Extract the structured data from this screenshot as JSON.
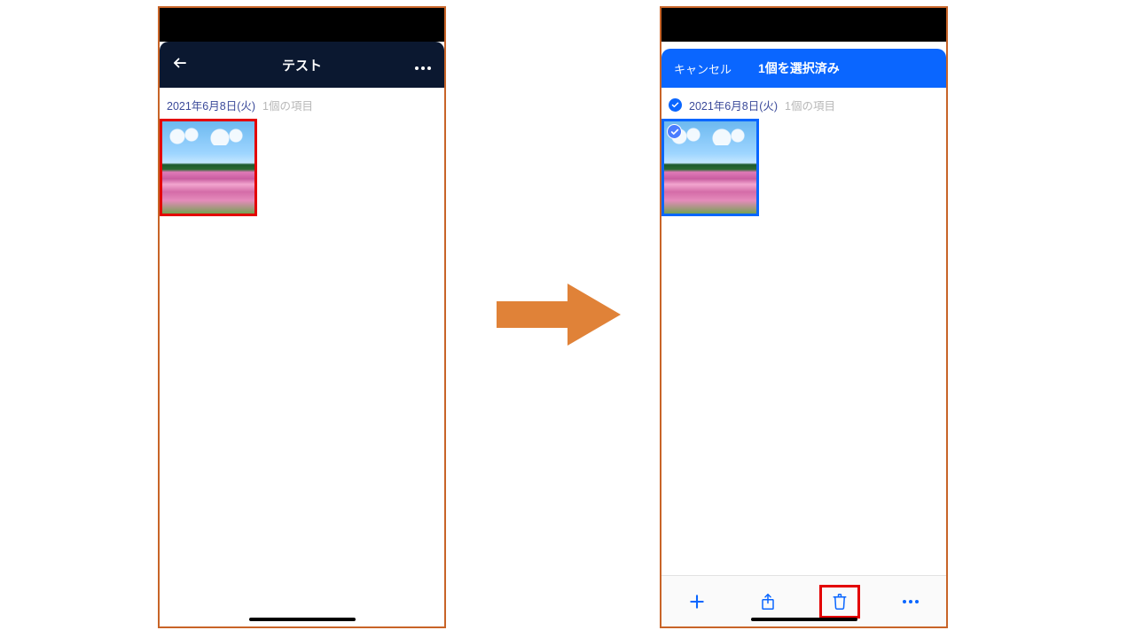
{
  "left": {
    "header": {
      "title": "テスト"
    },
    "section": {
      "date": "2021年6月8日(火)",
      "count": "1個の項目"
    }
  },
  "right": {
    "header": {
      "cancel": "キャンセル",
      "title": "1個を選択済み"
    },
    "section": {
      "date": "2021年6月8日(火)",
      "count": "1個の項目"
    },
    "toolbar": {
      "add": "add-icon",
      "share": "share-icon",
      "trash": "trash-icon",
      "more": "more-icon"
    }
  }
}
